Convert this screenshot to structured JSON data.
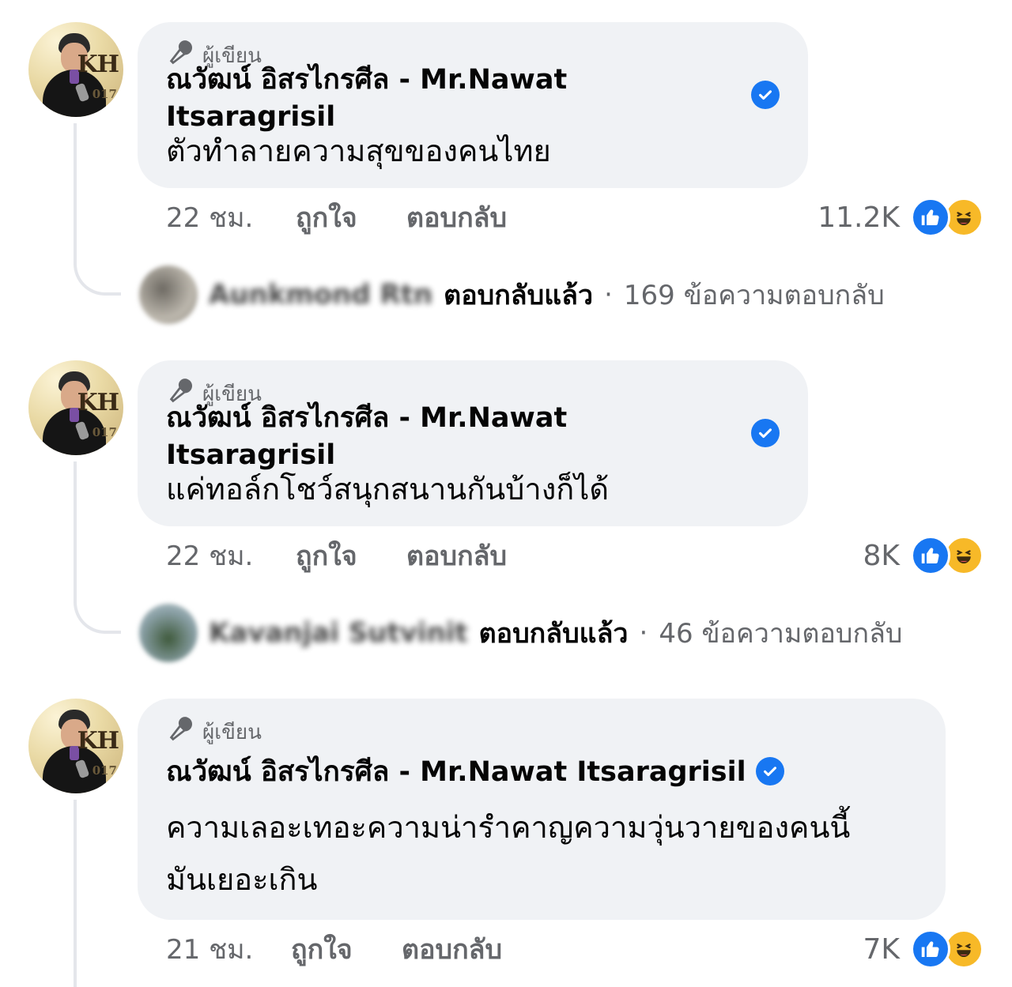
{
  "comments": [
    {
      "author_badge": "ผู้เขียน",
      "author_name": "ณวัฒน์ อิสรไกรศีล - Mr.Nawat Itsaragrisil",
      "text": "ตัวทำลายความสุขของคนไทย",
      "time": "22 ชม.",
      "like_label": "ถูกใจ",
      "reply_label": "ตอบกลับ",
      "reaction_count": "11.2K",
      "replies": {
        "name": "Aunkmond Rtn",
        "replied_label": "ตอบกลับแล้ว",
        "separator": "·",
        "summary": "169 ข้อความตอบกลับ"
      }
    },
    {
      "author_badge": "ผู้เขียน",
      "author_name": "ณวัฒน์ อิสรไกรศีล - Mr.Nawat Itsaragrisil",
      "text": "แค่ทอล์กโชว์สนุกสนานกันบ้างก็ได้",
      "time": "22 ชม.",
      "like_label": "ถูกใจ",
      "reply_label": "ตอบกลับ",
      "reaction_count": "8K",
      "replies": {
        "name": "Kavanjai Sutvinit",
        "replied_label": "ตอบกลับแล้ว",
        "separator": "·",
        "summary": "46 ข้อความตอบกลับ"
      }
    },
    {
      "author_badge": "ผู้เขียน",
      "author_name": "ณวัฒน์ อิสรไกรศีล - Mr.Nawat Itsaragrisil",
      "text_line1": "ความเลอะเทอะความน่ารำคาญความวุ่นวายของคนนี้",
      "text_line2": "มันเยอะเกิน",
      "time": "21 ชม.",
      "like_label": "ถูกใจ",
      "reply_label": "ตอบกลับ",
      "reaction_count": "7K"
    }
  ],
  "avatar_text": {
    "kh": "KH",
    "year": "017"
  },
  "icons": [
    "microphone-icon",
    "verified-badge-icon",
    "like-reaction-icon",
    "haha-reaction-icon"
  ],
  "colors": {
    "accent": "#1877f2",
    "bubble": "#f0f2f5",
    "muted": "#65676b",
    "haha": "#f7b928"
  }
}
